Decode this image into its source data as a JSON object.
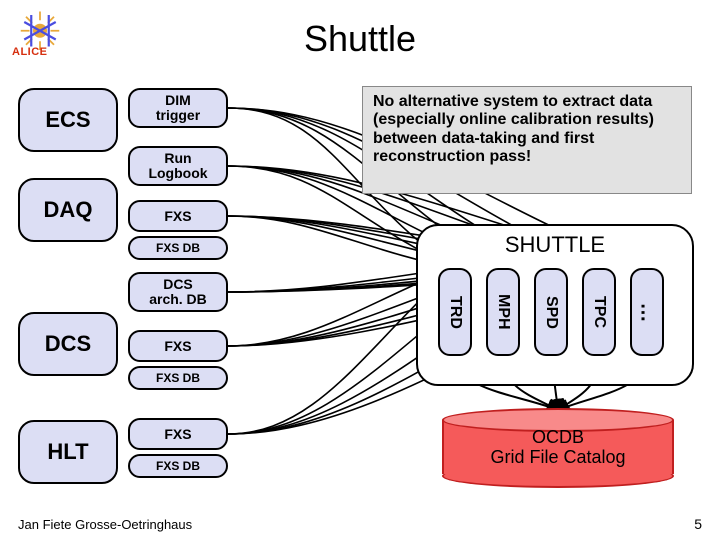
{
  "title": "Shuttle",
  "logo_text": "ALICE",
  "left_systems": {
    "ecs": "ECS",
    "daq": "DAQ",
    "dcs": "DCS",
    "hlt": "HLT"
  },
  "sources": {
    "dim_trigger": "DIM\ntrigger",
    "run_logbook": "Run\nLogbook",
    "daq_fxs": "FXS",
    "daq_fxsdb": "FXS DB",
    "dcs_archdb": "DCS\narch. DB",
    "dcs_fxs": "FXS",
    "dcs_fxsdb": "FXS DB",
    "hlt_fxs": "FXS",
    "hlt_fxsdb": "FXS DB"
  },
  "note": "No alternative system to extract data (especially online calibration results) between data-taking and first reconstruction pass!",
  "shuttle": {
    "title": "SHUTTLE",
    "detectors": [
      "TRD",
      "MPH",
      "SPD",
      "TPC",
      "…"
    ]
  },
  "ocdb": {
    "line1": "OCDB",
    "line2": "Grid File Catalog"
  },
  "footer": "Jan Fiete Grosse-Oetringhaus",
  "page": "5"
}
